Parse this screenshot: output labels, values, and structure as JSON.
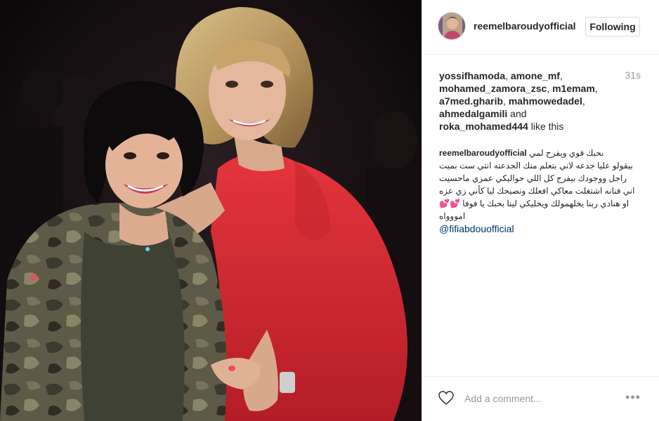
{
  "post": {
    "username": "reemelbaroudyofficial",
    "follow_label": "Following",
    "time_ago": "31s",
    "likes": {
      "names": [
        "yossifhamoda",
        "amone_mf",
        "mohamed_zamora_zsc",
        "m1emam",
        "a7med.gharib",
        "mahmowedadel",
        "ahmedalgamili",
        "roka_mohamed444"
      ],
      "sep_1": ", ",
      "and_text": " and",
      "suffix": " like this"
    },
    "caption": {
      "author": "reemelbaroudyofficial",
      "lines": [
        "بحبك قوي ويفرح لمي",
        "بيقولو عليا جدعه لاني بتعلم منك الجدعنه انتي ست بميت",
        "راجل ووجودك بيفرح كل اللي حواليكي عمري ماحسيت",
        "اني فنانه اشتغلت معاكي افعلك ونصيحك ليا كأني زي عزه",
        "او هنادي ربنا يخلهمولك ويخليكي لينا بحبك يا فوفا 💕💕",
        "امووواه"
      ],
      "mention": "@fifiabdouofficial"
    },
    "comment_placeholder": "Add a comment...",
    "more_label": "•••"
  },
  "icons": {
    "heart": "heart-outline-icon",
    "more": "more-options-icon"
  },
  "colors": {
    "link": "#003569",
    "muted": "#999999",
    "border": "#efefef",
    "text": "#262626"
  }
}
